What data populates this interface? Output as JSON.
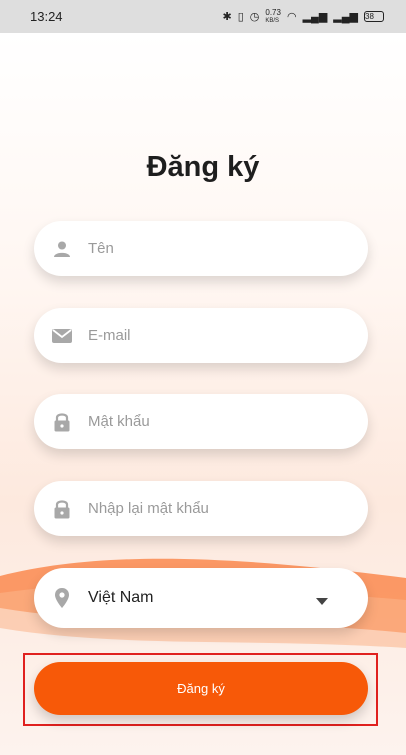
{
  "status_bar": {
    "time": "13:24",
    "net_speed": "0.73",
    "net_unit": "KB/S",
    "battery": "38"
  },
  "title": "Đăng ký",
  "form": {
    "name_placeholder": "Tên",
    "email_placeholder": "E-mail",
    "password_placeholder": "Mật khẩu",
    "confirm_password_placeholder": "Nhập lại mật khẩu",
    "country_value": "Việt Nam"
  },
  "submit_label": "Đăng ký",
  "colors": {
    "accent": "#f75908",
    "highlight_border": "#e0211f",
    "icon_gray": "#a8a8a8"
  }
}
